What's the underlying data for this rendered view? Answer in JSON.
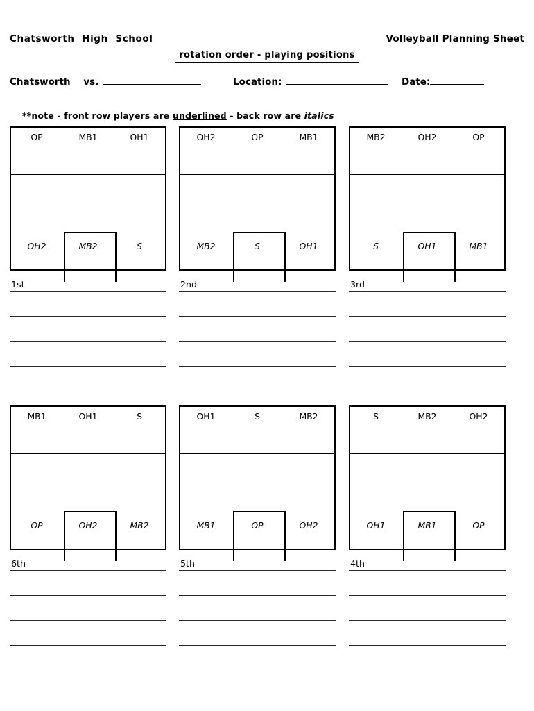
{
  "header": {
    "school": "Chatsworth  High  School",
    "doc_title": "Volleyball Planning Sheet",
    "subtitle": "rotation order - playing positions"
  },
  "fields": [
    {
      "label": "Chatsworth    vs.",
      "value": "",
      "name": "opponent"
    },
    {
      "label": "Location:",
      "value": "",
      "name": "location"
    },
    {
      "label": "Date:",
      "value": "",
      "name": "date"
    }
  ],
  "note": {
    "prefix": "**note - front row players are ",
    "underlined_word": "underlined",
    "middle": " - back row are ",
    "italic_word": "italics"
  },
  "legend": {
    "front_row_style": "underlined",
    "back_row_style": "italics"
  },
  "rotations": [
    {
      "label": "1st",
      "front_row": [
        "OP",
        "MB1",
        "OH1"
      ],
      "back_row": [
        "OH2",
        "MB2",
        "S"
      ],
      "server_position": "MB2"
    },
    {
      "label": "2nd",
      "front_row": [
        "OH2",
        "OP",
        "MB1"
      ],
      "back_row": [
        "MB2",
        "S",
        "OH1"
      ],
      "server_position": "S"
    },
    {
      "label": "3rd",
      "front_row": [
        "MB2",
        "OH2",
        "OP"
      ],
      "back_row": [
        "S",
        "OH1",
        "MB1"
      ],
      "server_position": "OH1"
    },
    {
      "label": "6th",
      "front_row": [
        "MB1",
        "OH1",
        "S"
      ],
      "back_row": [
        "OP",
        "OH2",
        "MB2"
      ],
      "server_position": "OH2"
    },
    {
      "label": "5th",
      "front_row": [
        "OH1",
        "S",
        "MB2"
      ],
      "back_row": [
        "MB1",
        "OP",
        "OH2"
      ],
      "server_position": "OP"
    },
    {
      "label": "4th",
      "front_row": [
        "S",
        "MB2",
        "OH2"
      ],
      "back_row": [
        "OH1",
        "MB1",
        "OP"
      ],
      "server_position": "MB1"
    }
  ],
  "notes_lines_per_rotation": 3,
  "colors": {
    "ink": "#000000",
    "rule": "#2a2a2a",
    "paper": "#ffffff"
  }
}
